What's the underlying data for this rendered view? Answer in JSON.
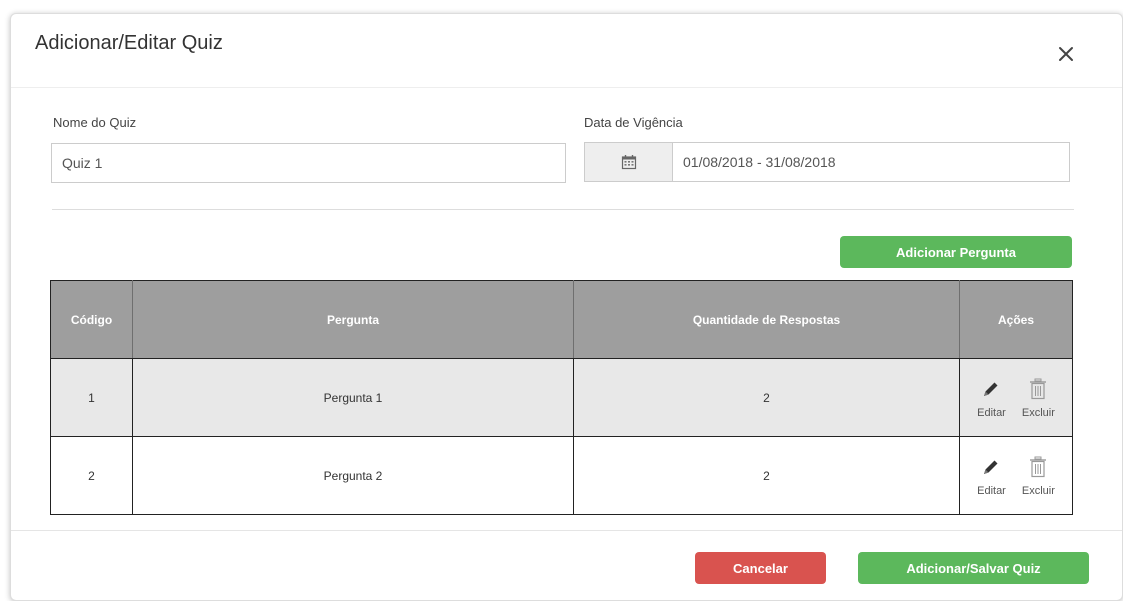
{
  "modal": {
    "title": "Adicionar/Editar Quiz"
  },
  "form": {
    "name_label": "Nome do Quiz",
    "name_value": "Quiz 1",
    "date_label": "Data de Vigência",
    "date_value": "01/08/2018 - 31/08/2018"
  },
  "toolbar": {
    "add_question_label": "Adicionar Pergunta"
  },
  "table": {
    "headers": {
      "code": "Código",
      "question": "Pergunta",
      "answers": "Quantidade de Respostas",
      "actions": "Ações"
    },
    "rows": [
      {
        "code": "1",
        "question": "Pergunta 1",
        "answers": "2",
        "edit": "Editar",
        "delete": "Excluir"
      },
      {
        "code": "2",
        "question": "Pergunta 2",
        "answers": "2",
        "edit": "Editar",
        "delete": "Excluir"
      }
    ]
  },
  "footer": {
    "cancel_label": "Cancelar",
    "save_label": "Adicionar/Salvar Quiz"
  },
  "icons": {
    "close": "close-icon",
    "calendar": "calendar-icon",
    "edit": "pencil-icon",
    "delete": "trash-icon"
  },
  "colors": {
    "primary_green": "#5cb85c",
    "danger_red": "#d9534f",
    "table_header": "#9e9e9e",
    "row_stripe": "#e8e8e8"
  }
}
